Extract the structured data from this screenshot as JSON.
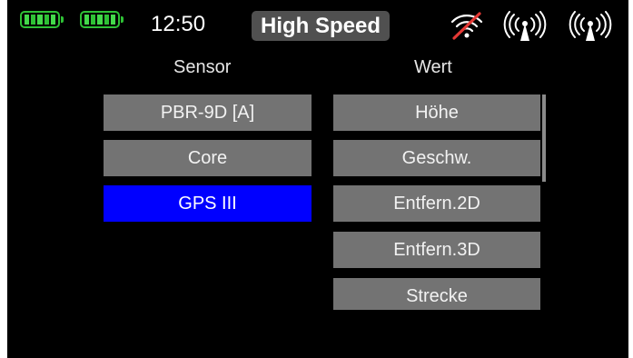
{
  "status_bar": {
    "battery_icons": [
      "battery-icon",
      "battery-icon"
    ],
    "time": "12:50",
    "mode": "High Speed",
    "icons": [
      "no-signal-icon",
      "antenna-icon",
      "antenna-icon"
    ],
    "colors": {
      "battery": "#2ec135",
      "no_signal": "#e53935",
      "badge": "#505050"
    }
  },
  "headers": {
    "sensor": "Sensor",
    "value": "Wert"
  },
  "sensors": [
    {
      "label": "PBR-9D [A]",
      "selected": false
    },
    {
      "label": "Core",
      "selected": false
    },
    {
      "label": "GPS III",
      "selected": true
    }
  ],
  "values": [
    {
      "label": "Höhe"
    },
    {
      "label": "Geschw."
    },
    {
      "label": "Entfern.2D"
    },
    {
      "label": "Entfern.3D"
    },
    {
      "label": "Strecke"
    }
  ],
  "colors": {
    "selected": "#0000ff",
    "button": "#737373",
    "background": "#000000"
  }
}
